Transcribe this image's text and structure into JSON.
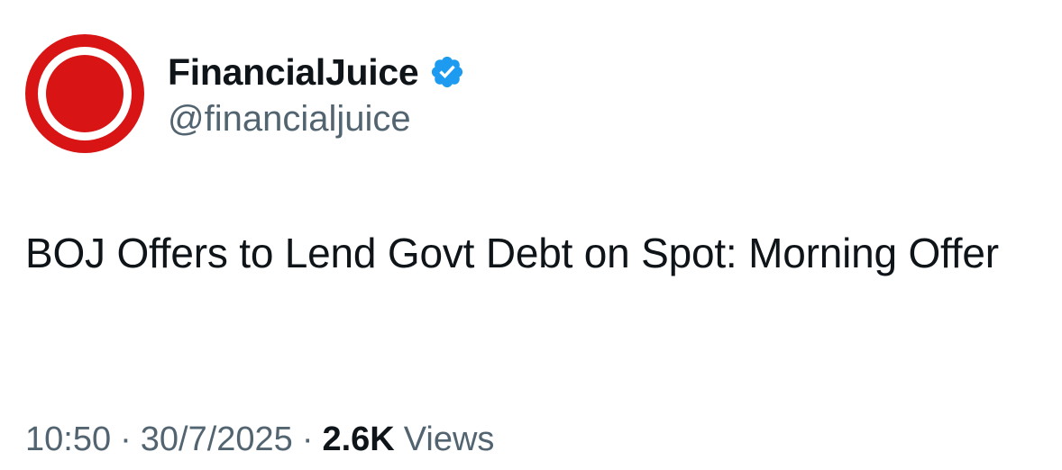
{
  "author": {
    "display_name": "FinancialJuice",
    "handle": "@financialjuice",
    "verified": true,
    "avatar_icon": "red-ring-logo",
    "verified_icon": "verified-badge-icon",
    "colors": {
      "avatar_red": "#d81414",
      "verified_blue": "#1d9bf0"
    }
  },
  "tweet": {
    "text": "BOJ Offers to Lend Govt Debt on Spot: Morning Offer"
  },
  "meta": {
    "time": "10:50",
    "separator": "·",
    "date": "30/7/2025",
    "views_count": "2.6K",
    "views_label": "Views"
  }
}
